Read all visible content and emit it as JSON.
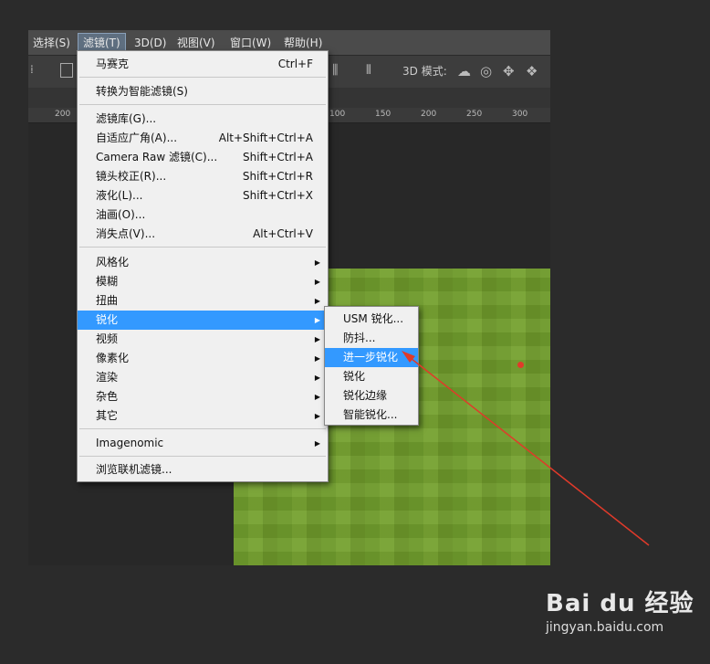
{
  "menubar": {
    "items": [
      {
        "label": "选择(S)"
      },
      {
        "label": "滤镜(T)"
      },
      {
        "label": "3D(D)"
      },
      {
        "label": "视图(V)"
      },
      {
        "label": "窗口(W)"
      },
      {
        "label": "帮助(H)"
      }
    ]
  },
  "options_bar": {
    "mode_label": "3D 模式:"
  },
  "ruler": {
    "ticks": [
      "200",
      "100",
      "150",
      "200",
      "250",
      "300"
    ]
  },
  "filter_menu": {
    "items": [
      {
        "label": "马赛克",
        "shortcut": "Ctrl+F"
      },
      {
        "label": "转换为智能滤镜(S)"
      },
      {
        "label": "滤镜库(G)..."
      },
      {
        "label": "自适应广角(A)...",
        "shortcut": "Alt+Shift+Ctrl+A"
      },
      {
        "label": "Camera Raw 滤镜(C)...",
        "shortcut": "Shift+Ctrl+A"
      },
      {
        "label": "镜头校正(R)...",
        "shortcut": "Shift+Ctrl+R"
      },
      {
        "label": "液化(L)...",
        "shortcut": "Shift+Ctrl+X"
      },
      {
        "label": "油画(O)..."
      },
      {
        "label": "消失点(V)...",
        "shortcut": "Alt+Ctrl+V"
      },
      {
        "label": "风格化"
      },
      {
        "label": "模糊"
      },
      {
        "label": "扭曲"
      },
      {
        "label": "锐化"
      },
      {
        "label": "视频"
      },
      {
        "label": "像素化"
      },
      {
        "label": "渲染"
      },
      {
        "label": "杂色"
      },
      {
        "label": "其它"
      },
      {
        "label": "Imagenomic"
      },
      {
        "label": "浏览联机滤镜..."
      }
    ]
  },
  "sharpen_submenu": {
    "items": [
      {
        "label": "USM 锐化..."
      },
      {
        "label": "防抖..."
      },
      {
        "label": "进一步锐化"
      },
      {
        "label": "锐化"
      },
      {
        "label": "锐化边缘"
      },
      {
        "label": "智能锐化..."
      }
    ]
  },
  "watermark": {
    "logo": "Bai du 经验",
    "url": "jingyan.baidu.com"
  },
  "colors": {
    "highlight": "#3399ff",
    "annotation": "#e03a2a",
    "image": "#74a030"
  }
}
